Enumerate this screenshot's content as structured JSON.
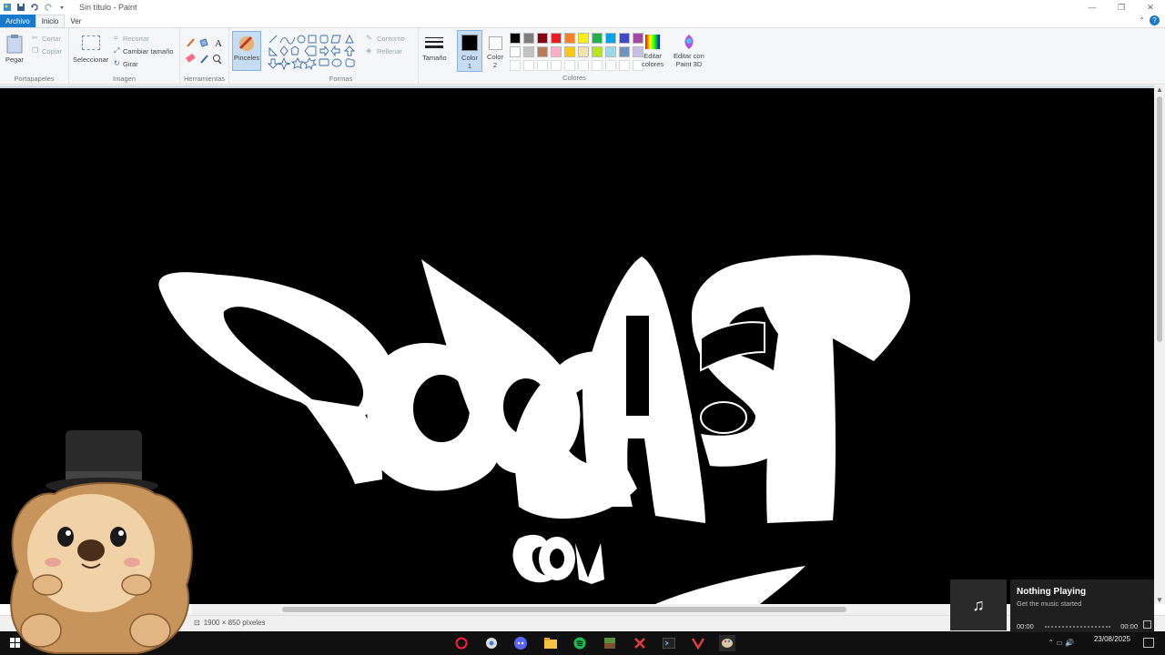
{
  "window": {
    "title": "Sin título - Paint",
    "controls": [
      "—",
      "❐",
      "✕"
    ]
  },
  "tabs": [
    {
      "label": "Archivo"
    },
    {
      "label": "Inicio"
    },
    {
      "label": "Ver"
    }
  ],
  "ribbon": {
    "clipboard": {
      "paste": "Pegar",
      "cut": "Cortar",
      "copy": "Copiar",
      "label": "Portapapeles"
    },
    "image": {
      "select": "Seleccionar",
      "crop": "Recortar",
      "resize": "Cambiar tamaño",
      "rotate": "Girar",
      "label": "Imagen"
    },
    "tools": {
      "label": "Herramientas"
    },
    "brushes": {
      "label": "Pinceles"
    },
    "shapes": {
      "outline": "Contorno",
      "fill": "Rellenar",
      "label": "Formas"
    },
    "size": {
      "label": "Tamaño"
    },
    "color1": {
      "line1": "Color",
      "line2": "1"
    },
    "color2": {
      "line1": "Color",
      "line2": "2"
    },
    "colors": {
      "label": "Colores"
    },
    "edit_colors": {
      "line1": "Editar",
      "line2": "colores"
    },
    "paint3d": {
      "line1": "Editar con",
      "line2": "Paint 3D"
    }
  },
  "palette": [
    "#000000",
    "#7f7f7f",
    "#880015",
    "#ed1c24",
    "#ff7f27",
    "#fff200",
    "#22b14c",
    "#00a2e8",
    "#3f48cc",
    "#a349a4",
    "#ffffff",
    "#c3c3c3",
    "#b97a57",
    "#ffaec9",
    "#ffc90e",
    "#efe4b0",
    "#b5e61d",
    "#99d9ea",
    "#7092be",
    "#c8bfe7",
    "#ffffff",
    "#ffffff",
    "#ffffff",
    "#ffffff",
    "#ffffff",
    "#ffffff",
    "#ffffff",
    "#ffffff",
    "#ffffff",
    "#ffffff"
  ],
  "canvas": {
    "art_text_main": "PODCAST",
    "art_text_sub": "cov"
  },
  "status": {
    "dimensions": "1900 × 850 píxeles"
  },
  "media": {
    "title": "Nothing Playing",
    "subtitle": "Get the music started",
    "time_start": "00:00",
    "time_end": "00:00"
  },
  "taskbar": {
    "date": "23/08/2025",
    "icons": [
      "opera-gx-icon",
      "chrome-icon",
      "discord-icon",
      "file-explorer-icon",
      "spotify-icon",
      "minecraft-icon",
      "app-x-icon",
      "terminal-icon",
      "app-v-icon",
      "paint-icon"
    ]
  }
}
